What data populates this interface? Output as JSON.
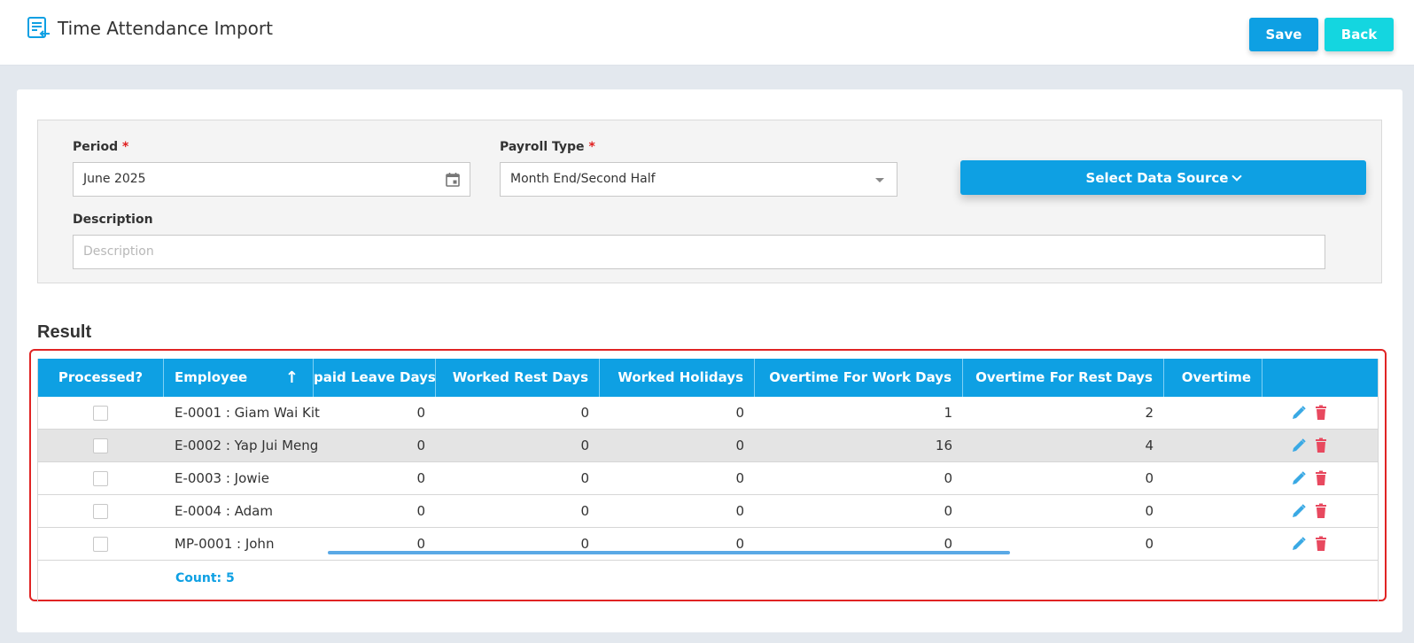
{
  "header": {
    "title": "Time Attendance Import",
    "save_label": "Save",
    "back_label": "Back",
    "icon": "import-list-icon"
  },
  "filters": {
    "period_label": "Period",
    "period_value": "June 2025",
    "payroll_type_label": "Payroll Type",
    "payroll_type_value": "Month End/Second Half",
    "description_label": "Description",
    "description_placeholder": "Description",
    "required_mark": "*",
    "select_source_label": "Select Data Source"
  },
  "result": {
    "title": "Result",
    "columns": {
      "processed": "Processed?",
      "employee": "Employee",
      "unpaid_leave": "paid Leave Days",
      "worked_rest": "Worked Rest Days",
      "worked_holidays": "Worked Holidays",
      "ot_work": "Overtime For Work Days",
      "ot_rest": "Overtime For Rest Days",
      "ot_more": "Overtime"
    },
    "sort_indicator": "↑",
    "rows": [
      {
        "employee": "E-0001 : Giam Wai Kit",
        "unpaid_leave": "0",
        "worked_rest": "0",
        "worked_holidays": "0",
        "ot_work": "1",
        "ot_rest": "2"
      },
      {
        "employee": "E-0002 : Yap Jui Meng",
        "unpaid_leave": "0",
        "worked_rest": "0",
        "worked_holidays": "0",
        "ot_work": "16",
        "ot_rest": "4"
      },
      {
        "employee": "E-0003 : Jowie",
        "unpaid_leave": "0",
        "worked_rest": "0",
        "worked_holidays": "0",
        "ot_work": "0",
        "ot_rest": "0"
      },
      {
        "employee": "E-0004 : Adam",
        "unpaid_leave": "0",
        "worked_rest": "0",
        "worked_holidays": "0",
        "ot_work": "0",
        "ot_rest": "0"
      },
      {
        "employee": "MP-0001 : John",
        "unpaid_leave": "0",
        "worked_rest": "0",
        "worked_holidays": "0",
        "ot_work": "0",
        "ot_rest": "0"
      }
    ],
    "count_label": "Count: 5"
  },
  "colors": {
    "primary": "#0ea0e3",
    "back": "#14d6e0",
    "delete": "#e8495f",
    "edit": "#3aa9e4",
    "highlight": "#e02424"
  }
}
